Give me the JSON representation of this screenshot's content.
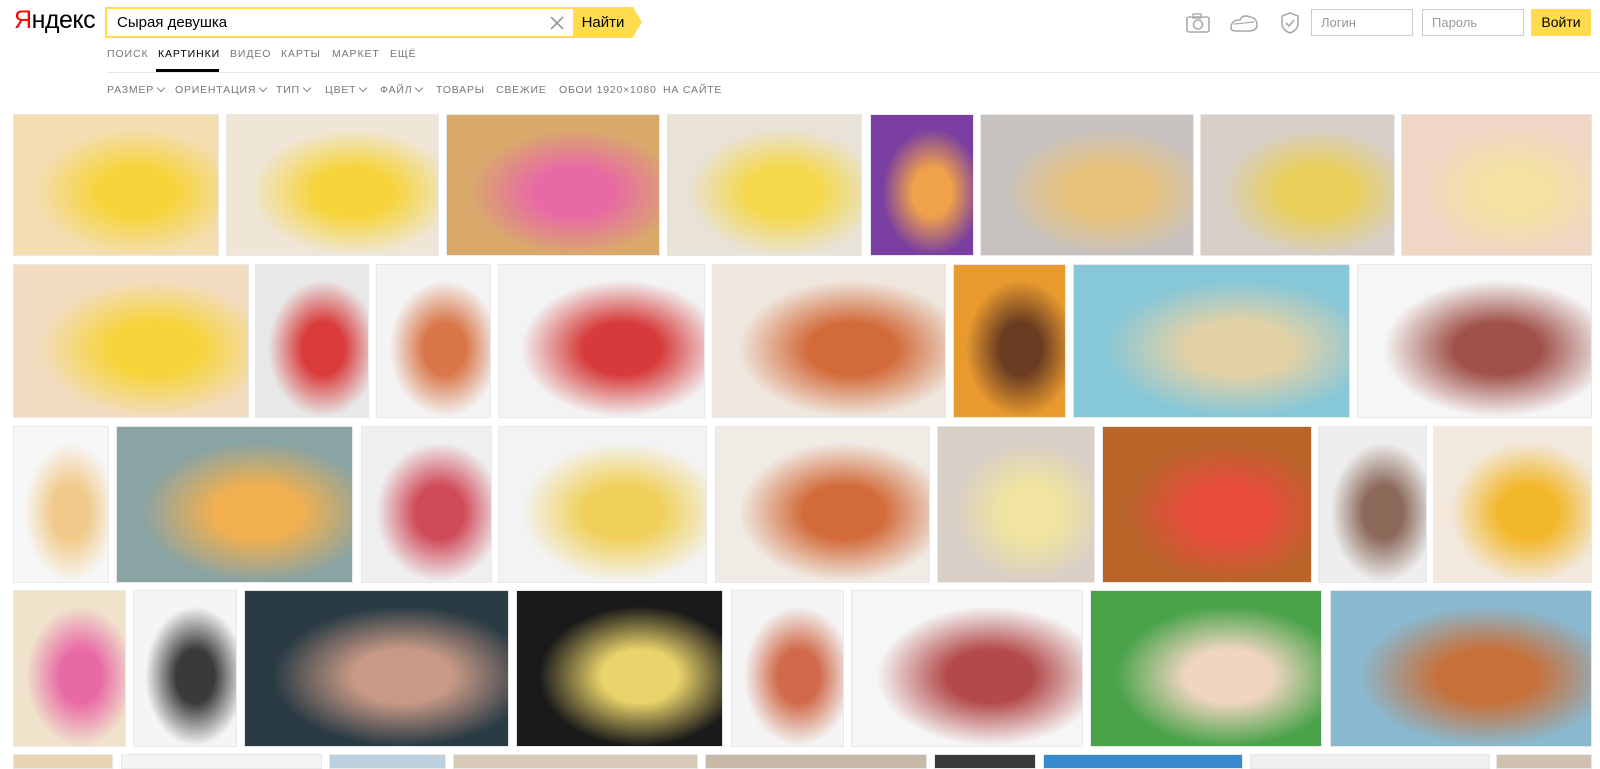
{
  "header": {
    "logo": "Яндекс",
    "search": {
      "value": "Сырая девушка",
      "button_label": "Найти"
    },
    "login_placeholder": "Логин",
    "password_placeholder": "Пароль",
    "login_button_label": "Войти",
    "icons": [
      "camera-icon",
      "weather-icon",
      "shield-icon",
      "clear-icon"
    ]
  },
  "tabs": [
    {
      "label": "Поиск"
    },
    {
      "label": "Картинки",
      "active": true
    },
    {
      "label": "Видео"
    },
    {
      "label": "Карты"
    },
    {
      "label": "Маркет"
    },
    {
      "label": "Ещё"
    }
  ],
  "filters": [
    {
      "label": "Размер",
      "dropdown": true
    },
    {
      "label": "Ориентация",
      "dropdown": true
    },
    {
      "label": "Тип",
      "dropdown": true
    },
    {
      "label": "Цвет",
      "dropdown": true
    },
    {
      "label": "Файл",
      "dropdown": true
    },
    {
      "label": "Товары",
      "dropdown": false
    },
    {
      "label": "Свежие",
      "dropdown": false
    },
    {
      "label": "Обои 1920×1080",
      "dropdown": false
    },
    {
      "label": "На сайте",
      "dropdown": false
    }
  ],
  "colors": {
    "accent": "#ffdb4d",
    "logo_red": "#ff0000",
    "muted": "#777777"
  }
}
